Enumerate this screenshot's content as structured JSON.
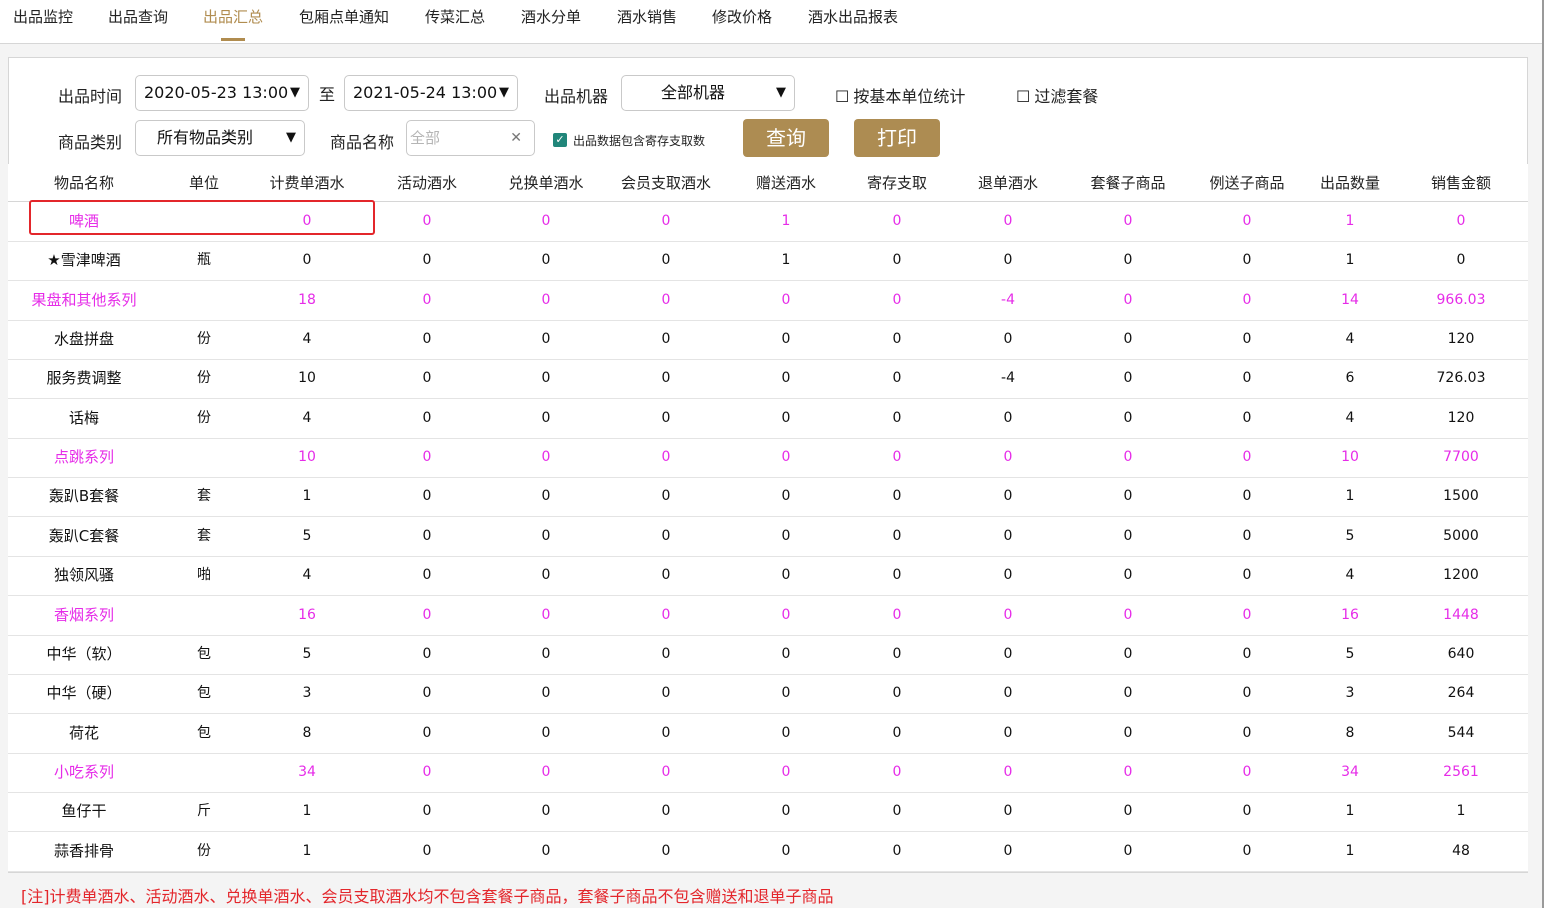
{
  "colors": {
    "accent": "#b08c4f",
    "button": "#ad8c52",
    "category_text": "#e62ce8",
    "highlight": "#e3262b",
    "note": "#e3262b",
    "checkbox": "#21867a"
  },
  "tabs": [
    "出品监控",
    "出品查询",
    "出品汇总",
    "包厢点单通知",
    "传菜汇总",
    "酒水分单",
    "酒水销售",
    "修改价格",
    "酒水出品报表"
  ],
  "active_tab": "出品汇总",
  "filters": {
    "time_label": "出品时间",
    "time_start": "2020-05-23 13:00",
    "to_label": "至",
    "time_end": "2021-05-24 13:00",
    "machine_label": "出品机器",
    "machine_value": "全部机器",
    "basic_unit_label": "按基本单位统计",
    "filter_package_label": "过滤套餐",
    "category_label": "商品类别",
    "category_value": "所有物品类别",
    "name_label": "商品名称",
    "name_placeholder": "全部",
    "include_storage_label": "出品数据包含寄存支取数",
    "include_storage_checked": true,
    "query_button": "查询",
    "print_button": "打印"
  },
  "table": {
    "headers": [
      "物品名称",
      "单位",
      "计费单酒水",
      "活动酒水",
      "兑换单酒水",
      "会员支取酒水",
      "赠送酒水",
      "寄存支取",
      "退单酒水",
      "套餐子商品",
      "例送子商品",
      "出品数量",
      "销售金额"
    ],
    "rows": [
      {
        "type": "category",
        "cells": [
          "啤酒",
          "",
          "0",
          "0",
          "0",
          "0",
          "1",
          "0",
          "0",
          "0",
          "0",
          "1",
          "0"
        ]
      },
      {
        "type": "item",
        "cells": [
          "★雪津啤酒",
          "瓶",
          "0",
          "0",
          "0",
          "0",
          "1",
          "0",
          "0",
          "0",
          "0",
          "1",
          "0"
        ]
      },
      {
        "type": "category",
        "cells": [
          "果盘和其他系列",
          "",
          "18",
          "0",
          "0",
          "0",
          "0",
          "0",
          "-4",
          "0",
          "0",
          "14",
          "966.03"
        ]
      },
      {
        "type": "item",
        "cells": [
          "水盘拼盘",
          "份",
          "4",
          "0",
          "0",
          "0",
          "0",
          "0",
          "0",
          "0",
          "0",
          "4",
          "120"
        ]
      },
      {
        "type": "item",
        "cells": [
          "服务费调整",
          "份",
          "10",
          "0",
          "0",
          "0",
          "0",
          "0",
          "-4",
          "0",
          "0",
          "6",
          "726.03"
        ]
      },
      {
        "type": "item",
        "cells": [
          "话梅",
          "份",
          "4",
          "0",
          "0",
          "0",
          "0",
          "0",
          "0",
          "0",
          "0",
          "4",
          "120"
        ]
      },
      {
        "type": "category",
        "cells": [
          "点跳系列",
          "",
          "10",
          "0",
          "0",
          "0",
          "0",
          "0",
          "0",
          "0",
          "0",
          "10",
          "7700"
        ]
      },
      {
        "type": "item",
        "cells": [
          "轰趴B套餐",
          "套",
          "1",
          "0",
          "0",
          "0",
          "0",
          "0",
          "0",
          "0",
          "0",
          "1",
          "1500"
        ]
      },
      {
        "type": "item",
        "cells": [
          "轰趴C套餐",
          "套",
          "5",
          "0",
          "0",
          "0",
          "0",
          "0",
          "0",
          "0",
          "0",
          "5",
          "5000"
        ]
      },
      {
        "type": "item",
        "cells": [
          "独领风骚",
          "啪",
          "4",
          "0",
          "0",
          "0",
          "0",
          "0",
          "0",
          "0",
          "0",
          "4",
          "1200"
        ]
      },
      {
        "type": "category",
        "cells": [
          "香烟系列",
          "",
          "16",
          "0",
          "0",
          "0",
          "0",
          "0",
          "0",
          "0",
          "0",
          "16",
          "1448"
        ]
      },
      {
        "type": "item",
        "cells": [
          "中华（软）",
          "包",
          "5",
          "0",
          "0",
          "0",
          "0",
          "0",
          "0",
          "0",
          "0",
          "5",
          "640"
        ]
      },
      {
        "type": "item",
        "cells": [
          "中华（硬）",
          "包",
          "3",
          "0",
          "0",
          "0",
          "0",
          "0",
          "0",
          "0",
          "0",
          "3",
          "264"
        ]
      },
      {
        "type": "item",
        "cells": [
          "荷花",
          "包",
          "8",
          "0",
          "0",
          "0",
          "0",
          "0",
          "0",
          "0",
          "0",
          "8",
          "544"
        ]
      },
      {
        "type": "category",
        "cells": [
          "小吃系列",
          "",
          "34",
          "0",
          "0",
          "0",
          "0",
          "0",
          "0",
          "0",
          "0",
          "34",
          "2561"
        ]
      },
      {
        "type": "item",
        "cells": [
          "鱼仔干",
          "斤",
          "1",
          "0",
          "0",
          "0",
          "0",
          "0",
          "0",
          "0",
          "0",
          "1",
          "1"
        ]
      },
      {
        "type": "item",
        "cells": [
          "蒜香排骨",
          "份",
          "1",
          "0",
          "0",
          "0",
          "0",
          "0",
          "0",
          "0",
          "0",
          "1",
          "48"
        ]
      }
    ]
  },
  "note": "[注]计费单酒水、活动酒水、兑换单酒水、会员支取酒水均不包含套餐子商品，套餐子商品不包含赠送和退单子商品"
}
